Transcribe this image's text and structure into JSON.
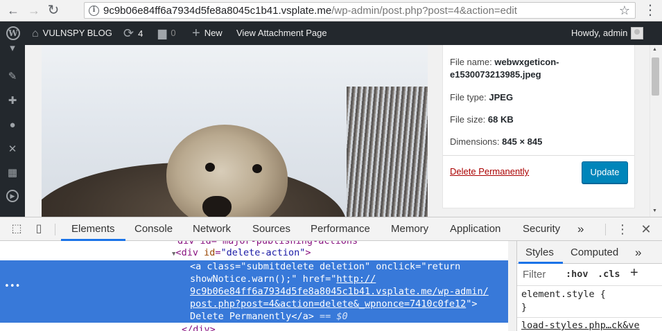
{
  "browser": {
    "url_host": "9c9b06e84ff6a7934d5fe8a8045c1b41.vsplate.me",
    "url_path": "/wp-admin/post.php?post=4&action=edit"
  },
  "adminbar": {
    "site_name": "VULNSPY BLOG",
    "updates_count": "4",
    "comments_count": "0",
    "new_label": "New",
    "view_label": "View Attachment Page",
    "greeting": "Howdy, admin"
  },
  "details": {
    "file_name_label": "File name:",
    "file_name_value": "webwxgeticon-e1530073213985.jpeg",
    "file_type_label": "File type:",
    "file_type_value": "JPEG",
    "file_size_label": "File size:",
    "file_size_value": "68 KB",
    "dimensions_label": "Dimensions:",
    "dimensions_value": "845 × 845",
    "delete_label": "Delete Permanently",
    "update_label": "Update"
  },
  "devtools": {
    "tabs": [
      "Elements",
      "Console",
      "Network",
      "Sources",
      "Performance",
      "Memory",
      "Application",
      "Security"
    ],
    "more_tabs": "»",
    "styles_tab": "Styles",
    "computed_tab": "Computed",
    "filter_placeholder": "Filter",
    "hov": ":hov",
    "cls": ".cls",
    "rule_element_style": "element.style {",
    "rule_close": "}",
    "stylesheet_link": "load-styles.php…ck&ve"
  },
  "dom": {
    "partial_top": "div id=\"major-publishing-actions\"",
    "div_tag": "div",
    "div_attr": "id",
    "div_val": "\"delete-action\"",
    "a_tag": "a",
    "a_class_attr": "class",
    "a_class_val": "\"submitdelete deletion\"",
    "a_onclick_attr": "onclick",
    "a_onclick_val_1": "\"return",
    "a_onclick_val_2": "showNotice.warn();\"",
    "a_href_attr": "href",
    "a_href_1": "http://",
    "a_href_2": "9c9b06e84ff6a7934d5fe8a8045c1b41.vsplate.me/wp-admin/",
    "a_href_3": "post.php?post=4&action=delete&_wpnonce=7410c0fe12",
    "a_text": "Delete Permanently",
    "dollar_zero": "== $0",
    "close_div": "</div>"
  }
}
